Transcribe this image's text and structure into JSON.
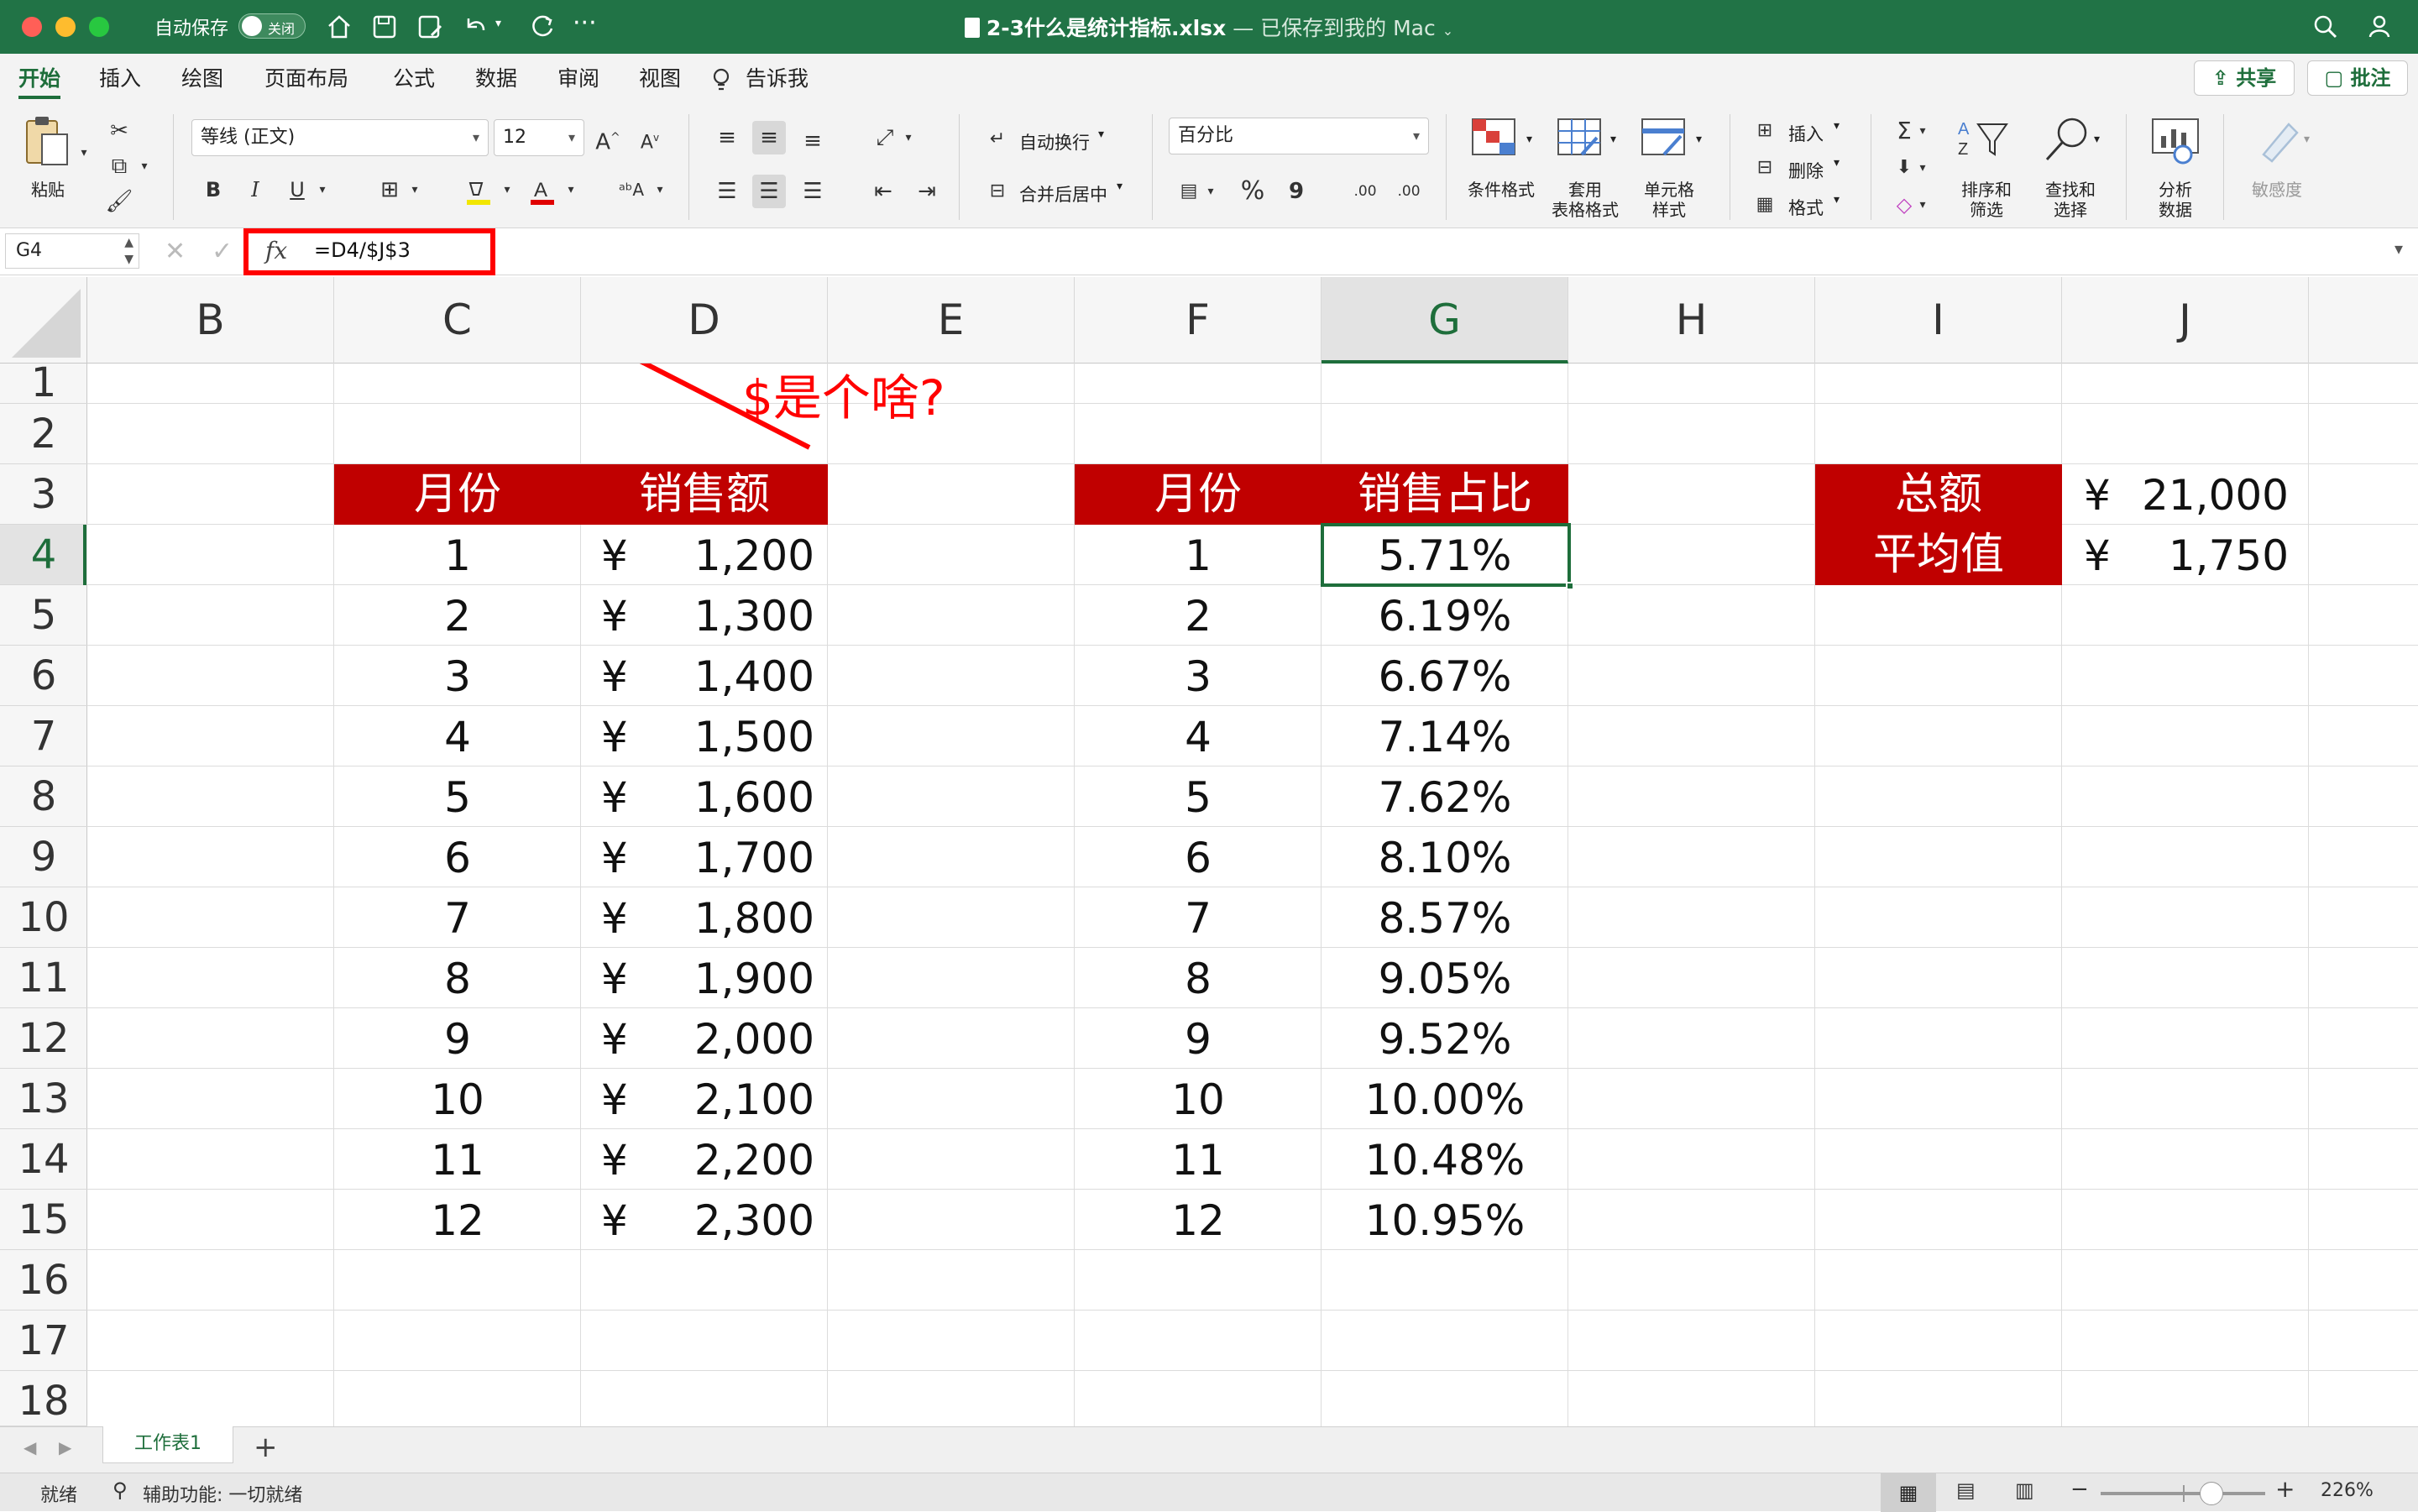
{
  "titlebar": {
    "autosave_label": "自动保存",
    "autosave_state": "关闭",
    "doc_title": "2-3什么是统计指标.xlsx",
    "doc_status": "— 已保存到我的 Mac",
    "colors": {
      "brand": "#217346",
      "close": "#ff5f57",
      "minimize": "#febc2e",
      "zoom": "#28c840"
    }
  },
  "tabs": [
    "开始",
    "插入",
    "绘图",
    "页面布局",
    "公式",
    "数据",
    "审阅",
    "视图",
    "告诉我"
  ],
  "share_label": "共享",
  "comment_label": "批注",
  "ribbon": {
    "paste_label": "粘贴",
    "font_name": "等线 (正文)",
    "font_size": "12",
    "wrap_text_label": "自动换行",
    "merge_label": "合并后居中",
    "number_format": "百分比",
    "conditional_format_label": "条件格式",
    "table_format_label_1": "套用",
    "table_format_label_2": "表格格式",
    "cell_style_label_1": "单元格",
    "cell_style_label_2": "样式",
    "insert_label": "插入",
    "delete_label": "删除",
    "format_label": "格式",
    "sort_filter_label_1": "排序和",
    "sort_filter_label_2": "筛选",
    "find_select_label_1": "查找和",
    "find_select_label_2": "选择",
    "analyze_label_1": "分析",
    "analyze_label_2": "数据",
    "sensitivity_label": "敏感度",
    "bold": "B",
    "italic": "I",
    "underline": "U",
    "percent": "%",
    "comma": "9",
    "dec_inc": ".00",
    "dec_dec": ".00"
  },
  "formula_bar": {
    "name_box": "G4",
    "fx": "fx",
    "formula": "=D4/$J$3"
  },
  "annotation": {
    "text": "$是个啥?",
    "color": "#ff0000"
  },
  "columns": [
    "B",
    "C",
    "D",
    "E",
    "F",
    "G",
    "H",
    "I",
    "J"
  ],
  "selected_column": "G",
  "rows": [
    "1",
    "2",
    "3",
    "4",
    "5",
    "6",
    "7",
    "8",
    "9",
    "10",
    "11",
    "12",
    "13",
    "14",
    "15",
    "16",
    "17",
    "18"
  ],
  "selected_row": "4",
  "table1": {
    "header_month": "月份",
    "header_sales": "销售额",
    "currency": "¥",
    "months": [
      "1",
      "2",
      "3",
      "4",
      "5",
      "6",
      "7",
      "8",
      "9",
      "10",
      "11",
      "12"
    ],
    "sales": [
      "1,200",
      "1,300",
      "1,400",
      "1,500",
      "1,600",
      "1,700",
      "1,800",
      "1,900",
      "2,000",
      "2,100",
      "2,200",
      "2,300"
    ]
  },
  "table2": {
    "header_month": "月份",
    "header_share": "销售占比",
    "months": [
      "1",
      "2",
      "3",
      "4",
      "5",
      "6",
      "7",
      "8",
      "9",
      "10",
      "11",
      "12"
    ],
    "shares": [
      "5.71%",
      "6.19%",
      "6.67%",
      "7.14%",
      "7.62%",
      "8.10%",
      "8.57%",
      "9.05%",
      "9.52%",
      "10.00%",
      "10.48%",
      "10.95%"
    ]
  },
  "summary": {
    "total_label": "总额",
    "total_currency": "¥",
    "total_value": "21,000",
    "avg_label": "平均值",
    "avg_currency": "¥",
    "avg_value": "1,750"
  },
  "header_fill_color": "#c00000",
  "sheet_tab": "工作表1",
  "add_sheet": "+",
  "status": {
    "ready": "就绪",
    "accessibility": "辅助功能: 一切就绪",
    "zoom": "226%",
    "zoom_minus": "−",
    "zoom_plus": "+"
  }
}
